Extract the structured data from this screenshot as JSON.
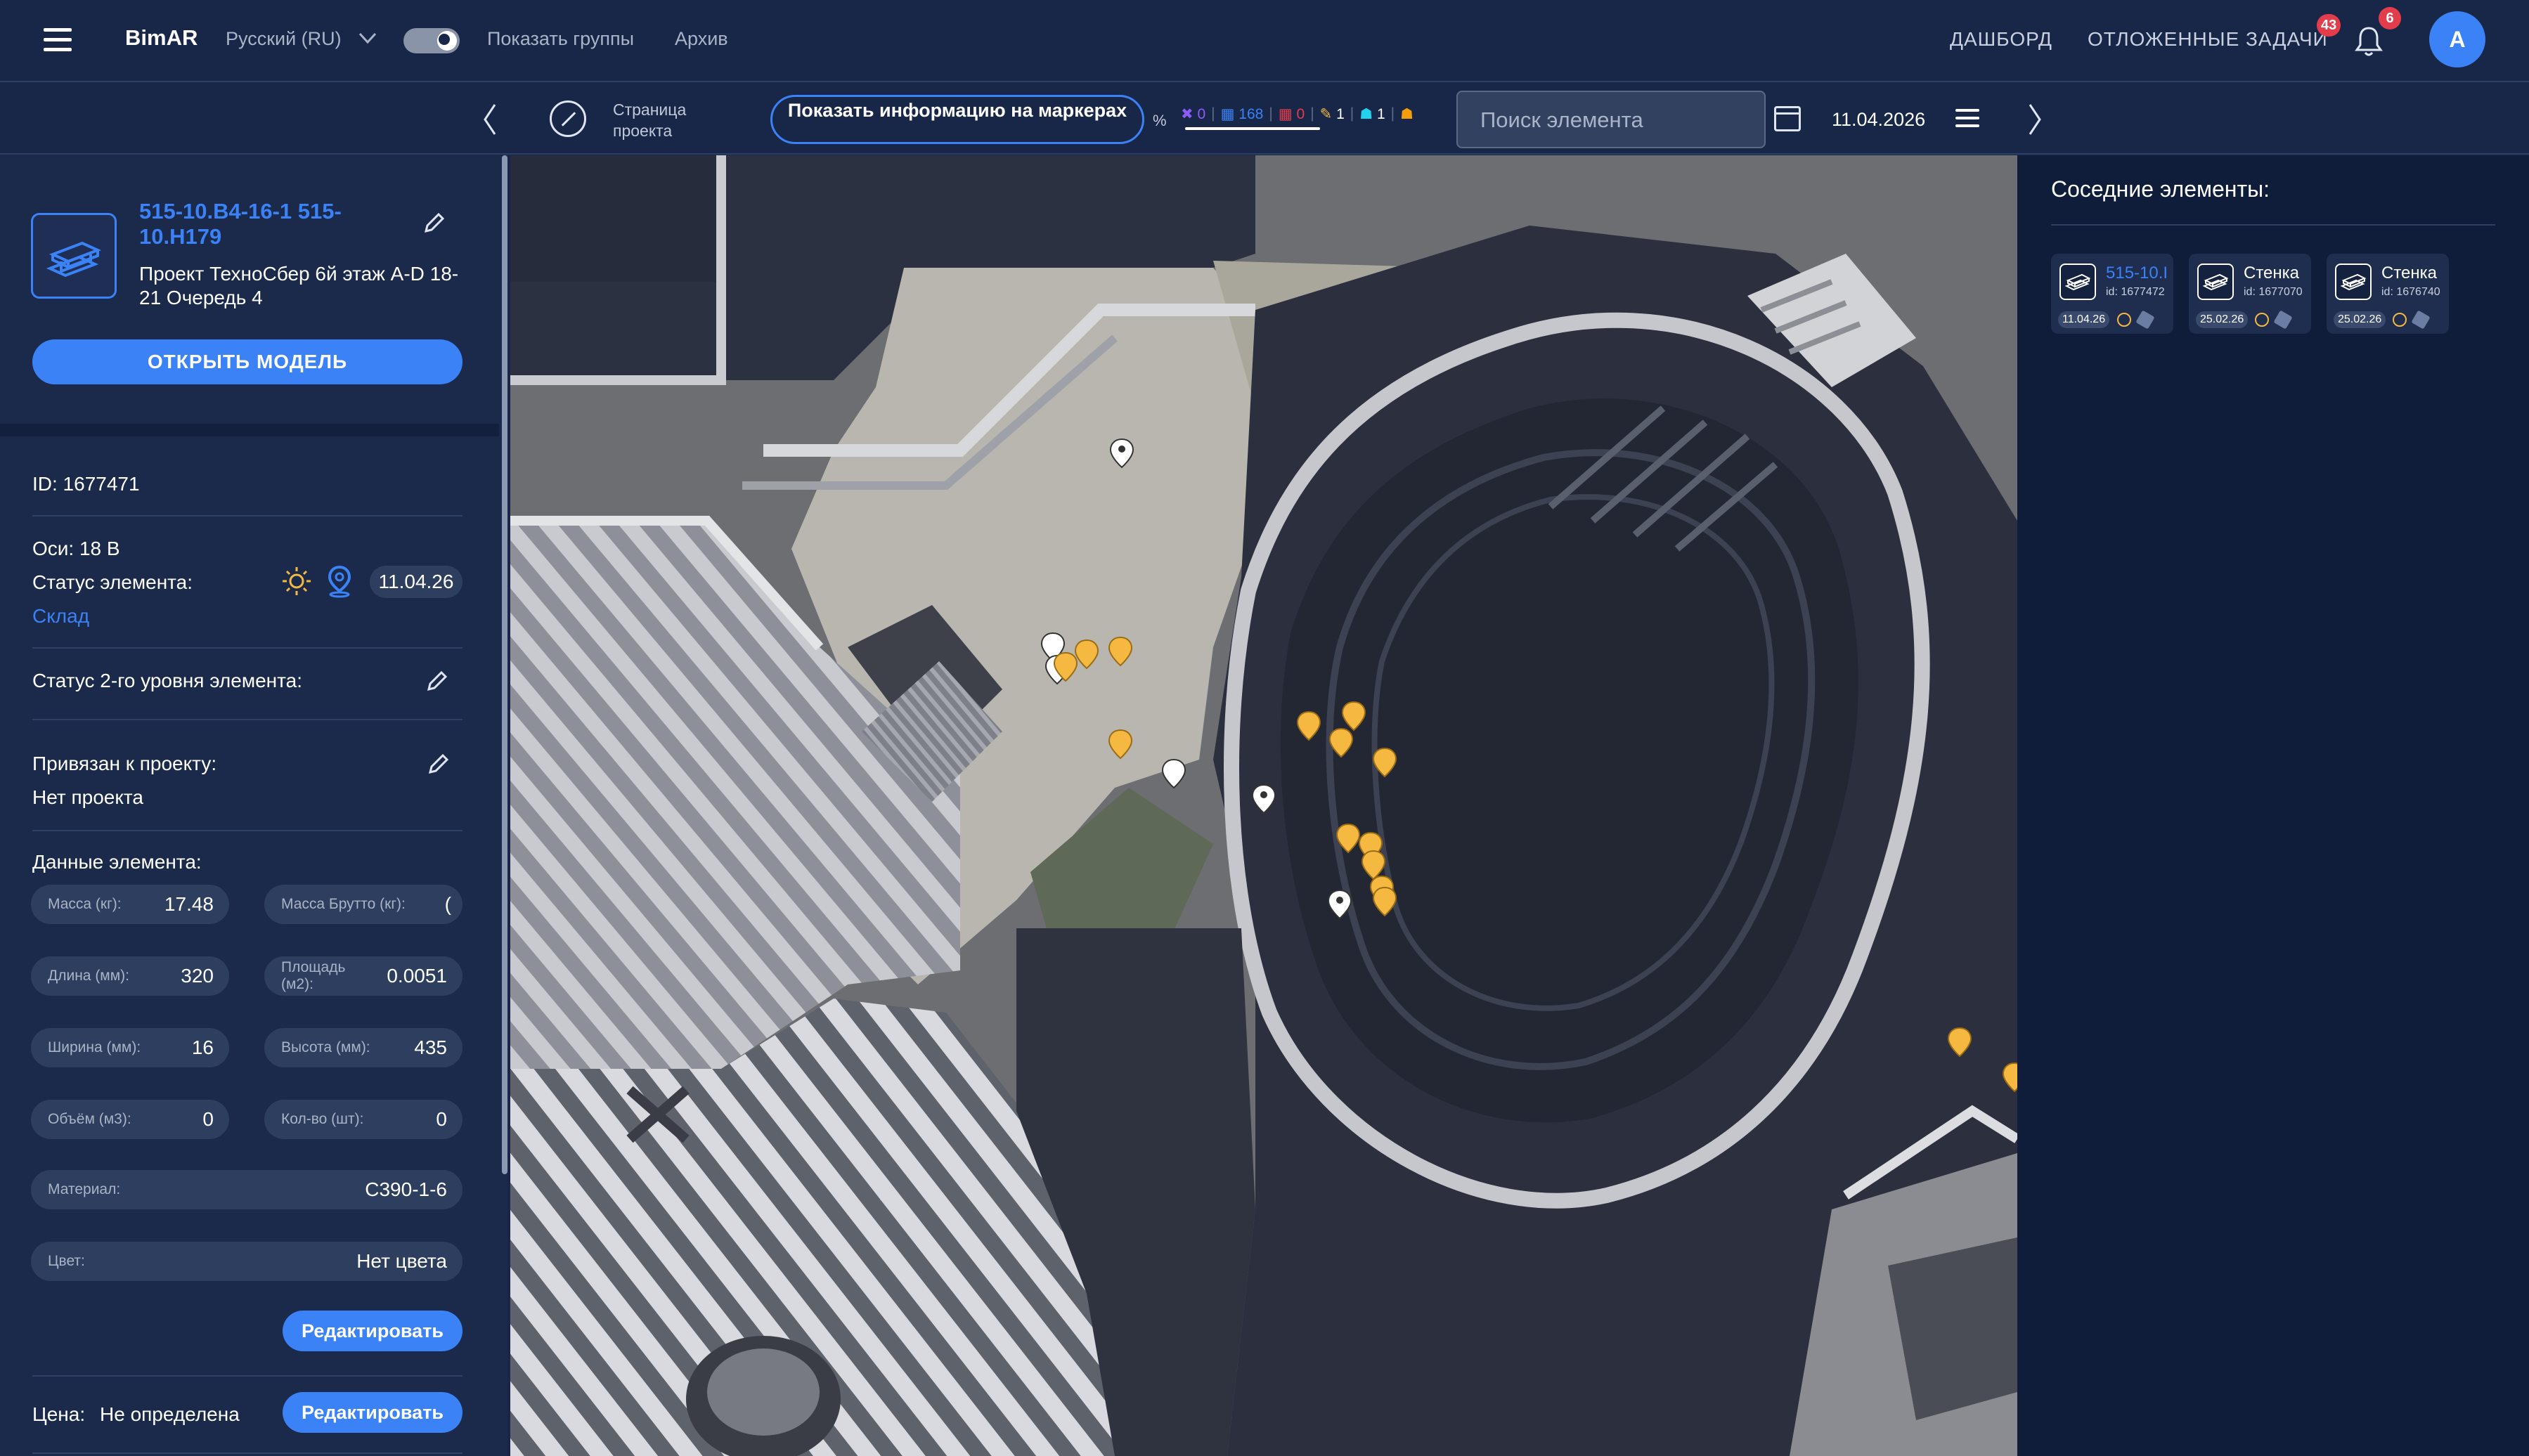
{
  "header": {
    "brand": "BimAR",
    "language": "Русский (RU)",
    "show_groups": "Показать группы",
    "archive": "Архив",
    "dashboard": "ДАШБОРД",
    "deferred_tasks": "ОТЛОЖЕННЫЕ ЗАДАЧИ",
    "deferred_badge": "43",
    "notifications_badge": "6",
    "avatar_letter": "A"
  },
  "toolbar": {
    "project_page": "Страница проекта",
    "markers_button": "Показать информацию на маркерах",
    "percent": "%",
    "stats": [
      {
        "icon": "✖",
        "value": "0",
        "color": "#8b5cf6"
      },
      {
        "icon": "▦",
        "value": "168",
        "color": "#3b82f6"
      },
      {
        "icon": "▦",
        "value": "0",
        "color": "#e33c4a"
      },
      {
        "icon": "✎",
        "value": "1",
        "color": "#f5b942"
      },
      {
        "icon": "☗",
        "value": "1",
        "color": "#22d3ee"
      },
      {
        "icon": "☗",
        "value": "",
        "color": "#f59e0b"
      }
    ],
    "search_placeholder": "Поиск элемента",
    "date": "11.04.2026"
  },
  "element": {
    "title": "515-10.B4-16-1 515-10.H179",
    "project": "Проект ТехноСбер 6й этаж A-D 18-21 Очередь 4",
    "open_model": "ОТКРЫТЬ МОДЕЛЬ",
    "id_label": "ID: 1677471",
    "axes": "Оси: 18 B",
    "status_label": "Статус элемента:",
    "status_value": "Склад",
    "status_date": "11.04.26",
    "status2_label": "Статус 2-го уровня элемента:",
    "linked_label": "Привязан к проекту:",
    "linked_value": "Нет проекта",
    "data_label": "Данные элемента:",
    "fields": {
      "mass": {
        "label": "Масса (кг):",
        "value": "17.48"
      },
      "mass_gross": {
        "label": "Масса Брутто (кг):",
        "value": "("
      },
      "length": {
        "label": "Длина (мм):",
        "value": "320"
      },
      "area": {
        "label": "Площадь (м2):",
        "value": "0.0051"
      },
      "width": {
        "label": "Ширина (мм):",
        "value": "16"
      },
      "height": {
        "label": "Высота (мм):",
        "value": "435"
      },
      "volume": {
        "label": "Объём (м3):",
        "value": "0"
      },
      "qty": {
        "label": "Кол-во (шт):",
        "value": "0"
      },
      "material": {
        "label": "Материал:",
        "value": "С390-1-6"
      },
      "color": {
        "label": "Цвет:",
        "value": "Нет цвета"
      }
    },
    "edit_button": "Редактировать",
    "price_label": "Цена:",
    "price_value": "Не определена",
    "edit_price_button": "Редактировать"
  },
  "map": {
    "marker_white_color": "#ffffff",
    "marker_yellow_color": "#f5b942"
  },
  "neighbors": {
    "title": "Соседние элементы:",
    "items": [
      {
        "name": "515-10.I",
        "id": "id: 1677472",
        "date": "11.04.26",
        "highlight": true
      },
      {
        "name": "Стенка",
        "id": "id: 1677070",
        "date": "25.02.26",
        "highlight": false
      },
      {
        "name": "Стенка",
        "id": "id: 1676740",
        "date": "25.02.26",
        "highlight": false
      }
    ]
  }
}
